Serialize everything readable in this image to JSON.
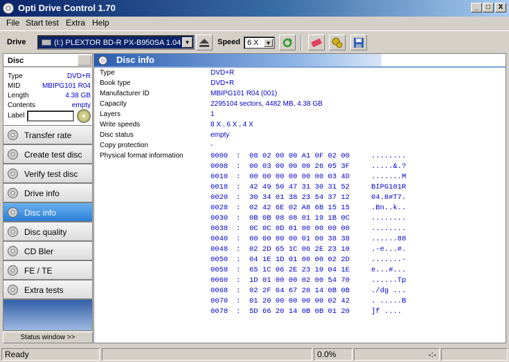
{
  "window": {
    "title": "Opti Drive Control 1.70",
    "minimize": "_",
    "maximize": "□",
    "close": "X"
  },
  "menu": [
    {
      "label": "File"
    },
    {
      "label": "Start test"
    },
    {
      "label": "Extra"
    },
    {
      "label": "Help"
    }
  ],
  "toolbar": {
    "drive_label": "Drive",
    "drive_value": "(I:)   PLEXTOR BD-R  PX-B950SA 1.04",
    "speed_label": "Speed",
    "speed_value": "6 X"
  },
  "disc_panel": {
    "header": "Disc",
    "props": [
      {
        "key": "Type",
        "value": "DVD+R"
      },
      {
        "key": "MID",
        "value": "MBIPG101 R04"
      },
      {
        "key": "Length",
        "value": "4.38 GB"
      },
      {
        "key": "Contents",
        "value": "empty"
      }
    ],
    "label_label": "Label"
  },
  "nav": [
    {
      "label": "Transfer rate"
    },
    {
      "label": "Create test disc"
    },
    {
      "label": "Verify test disc"
    },
    {
      "label": "Drive info"
    },
    {
      "label": "Disc info"
    },
    {
      "label": "Disc quality"
    },
    {
      "label": "CD Bler"
    },
    {
      "label": "FE / TE"
    },
    {
      "label": "Extra tests"
    }
  ],
  "status_window_label": "Status window >>",
  "content": {
    "title": "Disc info",
    "rows": [
      {
        "key": "Type",
        "value": "DVD+R"
      },
      {
        "key": "Book type",
        "value": "DVD+R"
      },
      {
        "key": "Manufacturer ID",
        "value": "MBIPG101 R04 (001)"
      },
      {
        "key": "Capacity",
        "value": "2295104 sectors, 4482 MB, 4.38 GB"
      },
      {
        "key": "Layers",
        "value": "1"
      },
      {
        "key": "Write speeds",
        "value": "8 X , 6 X , 4 X"
      },
      {
        "key": "Disc status",
        "value": "empty"
      },
      {
        "key": "Copy protection",
        "value": "-"
      },
      {
        "key": "Physical format information",
        "value": ""
      }
    ],
    "hex": [
      {
        "off": "0000",
        "bytes": "08 02 00 00 A1 0F 02 00",
        "ascii": "........"
      },
      {
        "off": "0008",
        "bytes": "00 03 00 00 00 26 05 3F",
        "ascii": ".....&.?"
      },
      {
        "off": "0010",
        "bytes": "00 00 00 00 00 00 03 4D",
        "ascii": ".......M"
      },
      {
        "off": "0018",
        "bytes": "42 49 50 47 31 30 31 52",
        "ascii": "BIPG101R"
      },
      {
        "off": "0020",
        "bytes": "30 34 01 38 23 54 37 12",
        "ascii": "04.8#T7."
      },
      {
        "off": "0028",
        "bytes": "02 42 6E 02 A8 6B 15 15",
        "ascii": ".Bn..k.."
      },
      {
        "off": "0030",
        "bytes": "0B 0B 08 08 01 19 1B 0C",
        "ascii": "........"
      },
      {
        "off": "0038",
        "bytes": "0C 0C 0D 01 00 00 00 00",
        "ascii": "........"
      },
      {
        "off": "0040",
        "bytes": "00 00 00 00 01 00 38 38",
        "ascii": "......88"
      },
      {
        "off": "0048",
        "bytes": "02 2D 65 1C 06 2E 23 10",
        "ascii": ".-e...#."
      },
      {
        "off": "0050",
        "bytes": "04 1E 1D 01 00 00 02 2D",
        "ascii": ".......-"
      },
      {
        "off": "0058",
        "bytes": "65 1C 06 2E 23 10 04 1E",
        "ascii": "e...#..."
      },
      {
        "off": "0060",
        "bytes": "1D 01 00 00 02 00 54 70",
        "ascii": "......Tp"
      },
      {
        "off": "0068",
        "bytes": "02 2F 64 67 20 14 0B 0B",
        "ascii": "./dg ..."
      },
      {
        "off": "0070",
        "bytes": "01 20 00 00 00 00 02 42",
        "ascii": ". .....B"
      },
      {
        "off": "0078",
        "bytes": "5D 66 20 14 0B 0B 01 20",
        "ascii": "]f ...."
      }
    ]
  },
  "statusbar": {
    "status": "Ready",
    "progress": "0.0%",
    "time": "-:-"
  }
}
